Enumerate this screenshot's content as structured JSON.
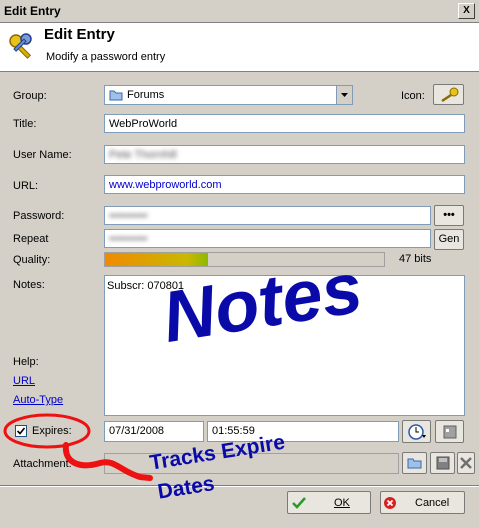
{
  "window": {
    "title": "Edit Entry",
    "close_glyph": "X"
  },
  "header": {
    "title": "Edit Entry",
    "subtitle": "Modify a password entry",
    "icon": "keys-icon"
  },
  "form": {
    "group_label": "Group:",
    "group_value": "Forums",
    "icon_label": "Icon:",
    "title_label": "Title:",
    "title_value": "WebProWorld",
    "username_label": "User Name:",
    "username_value": "Pete Thornhill",
    "url_label": "URL:",
    "url_value": "www.webproworld.com",
    "password_label": "Password:",
    "password_value": "••••••••••",
    "show_button": "•••",
    "repeat_label": "Repeat",
    "repeat_value": "••••••••••",
    "gen_button": "Gen",
    "quality_label": "Quality:",
    "quality_bits": "47 bits",
    "quality_fraction": 0.37,
    "notes_label": "Notes:",
    "notes_value": "Subscr:  070801",
    "help_label": "Help:",
    "help_url": "URL",
    "help_autotype": "Auto-Type",
    "expires_label": "Expires:",
    "expires_checked": true,
    "expires_date": "07/31/2008",
    "expires_time": "01:55:59",
    "attachment_label": "Attachment:"
  },
  "buttons": {
    "ok": "OK",
    "cancel": "Cancel"
  },
  "annotations": {
    "notes_overlay": "Notes",
    "tracks_line1": "Tracks Expire",
    "tracks_line2": "Dates"
  },
  "colors": {
    "annotation_blue": "#0a0aa8",
    "annotation_red": "#ee1111",
    "quality_fill": "#e8a200",
    "link": "#0000cc"
  }
}
